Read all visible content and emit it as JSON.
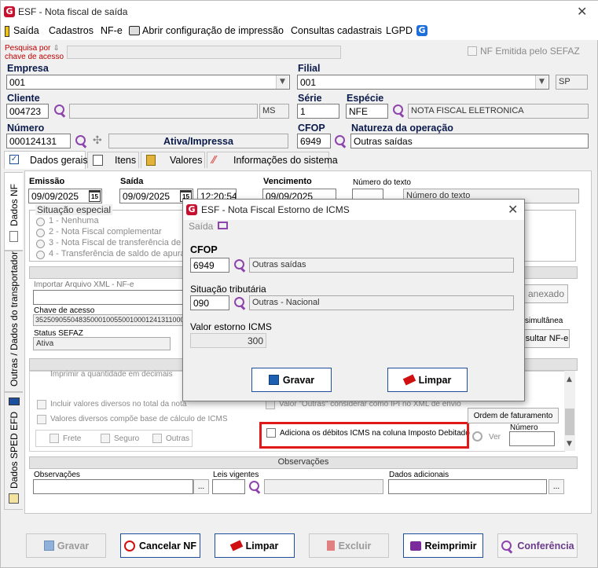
{
  "window": {
    "title": "ESF - Nota fiscal de saída"
  },
  "menu": [
    "Saída",
    "Cadastros",
    "NF-e",
    "Abrir configuração de impressão",
    "Consultas cadastrais",
    "LGPD"
  ],
  "top": {
    "pesquisa_label": "Pesquisa por chave de acesso",
    "nf_emitida_label": "NF Emitida pelo SEFAZ",
    "empresa_label": "Empresa",
    "empresa_value": "001",
    "filial_label": "Filial",
    "filial_value": "001",
    "filial_uf": "SP",
    "cliente_label": "Cliente",
    "cliente_value": "004723",
    "cliente_uf": "MS",
    "serie_label": "Série",
    "serie_value": "1",
    "especie_label": "Espécie",
    "especie_code": "NFE",
    "especie_desc": "NOTA FISCAL ELETRONICA",
    "numero_label": "Número",
    "numero_value": "000124131",
    "status": "Ativa/Impressa",
    "cfop_label": "CFOP",
    "cfop_value": "6949",
    "natureza_label": "Natureza da operação",
    "natureza_value": "Outras saídas"
  },
  "tabs": [
    "Dados gerais",
    "Itens",
    "Valores",
    "Informações do sistema"
  ],
  "vtabs": [
    "Dados NF",
    "Outras / Dados do transportador",
    "Dados SPED EFD"
  ],
  "dados": {
    "emissao_label": "Emissão",
    "emissao_value": "09/09/2025",
    "saida_label": "Saída",
    "saida_value": "09/09/2025",
    "saida_hora": "12:20:54",
    "vencimento_label": "Vencimento",
    "vencimento_value": "09/09/2025",
    "numero_texto_label": "Número do texto",
    "numero_texto_value": "Número do texto",
    "situacao_label": "Situação especial",
    "situacao_options": [
      "1 - Nenhuma",
      "2 - Nota Fiscal complementar",
      "3 - Nota Fiscal de transferência de I",
      "4 - Transferência de saldo de apura"
    ],
    "importar_label": "Importar Arquivo XML - NF-e",
    "chave_label": "Chave de acesso",
    "chave_value": "35250905504835000100550010001241311000",
    "status_sefaz_label": "Status SEFAZ",
    "status_sefaz_value": "Ativa",
    "anexado_label": "anexado",
    "simultanea_label": "simultânea",
    "consultar_label": "sultar NF-e",
    "imprimir_label": "Imprimir a quantidade em decimais",
    "incluir_label": "Incluir valores diversos no total da nota",
    "valores_diversos_label": "Valores diversos compõe base de cálculo de ICMS",
    "valor_outras_label": "Valor \"Outras\" considerar como IPI no XML de envio",
    "frete_label": "Frete",
    "seguro_label": "Seguro",
    "outras_label": "Outras",
    "ordem_label": "Ordem de faturamento",
    "numero_ordem_label": "Número",
    "ver_label": "Ver",
    "adiciona_label": "Adiciona os débitos ICMS na coluna Imposto Debitado",
    "observacoes_group": "Observações",
    "observacoes_label": "Observações",
    "leis_label": "Leis vigentes",
    "dados_adicionais_label": "Dados adicionais",
    "ellipsis": "..."
  },
  "modal": {
    "title": "ESF - Nota Fiscal Estorno de ICMS",
    "menu_saida": "Saída",
    "cfop_label": "CFOP",
    "cfop_value": "6949",
    "cfop_desc": "Outras saídas",
    "situacao_label": "Situação tributária",
    "situacao_value": "090",
    "situacao_desc": "Outras - Nacional",
    "valor_label": "Valor estorno ICMS",
    "valor_value": "300",
    "gravar_label": "Gravar",
    "limpar_label": "Limpar"
  },
  "bottom": {
    "gravar": "Gravar",
    "cancelar": "Cancelar NF",
    "limpar": "Limpar",
    "excluir": "Excluir",
    "reimprimir": "Reimprimir",
    "conferencia": "Conferência"
  },
  "colors": {
    "accent_purple": "#8e44ad",
    "logo_red": "#c8102e",
    "highlight_red": "#e01818",
    "label_navy": "#0a1a4a"
  }
}
